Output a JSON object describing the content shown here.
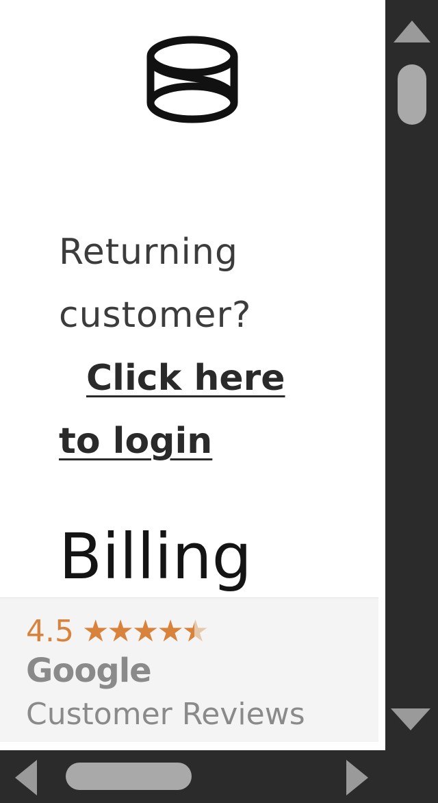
{
  "logo": {
    "icon": "brand-logo-icon"
  },
  "checkout": {
    "returning_prompt": "Returning customer?",
    "login_link_line1": "Click here",
    "login_link_line2": "to login"
  },
  "billing": {
    "heading": "Billing"
  },
  "reviews_badge": {
    "rating": "4.5",
    "stars": "★★★★",
    "stars_value": 4.5,
    "stars_max": 5,
    "brand": "Google",
    "label": "Customer Reviews"
  },
  "colors": {
    "accent_orange": "#d9823c",
    "scrollbar_bg": "#2b2b2b",
    "scrollbar_thumb": "#a9a9a9"
  }
}
